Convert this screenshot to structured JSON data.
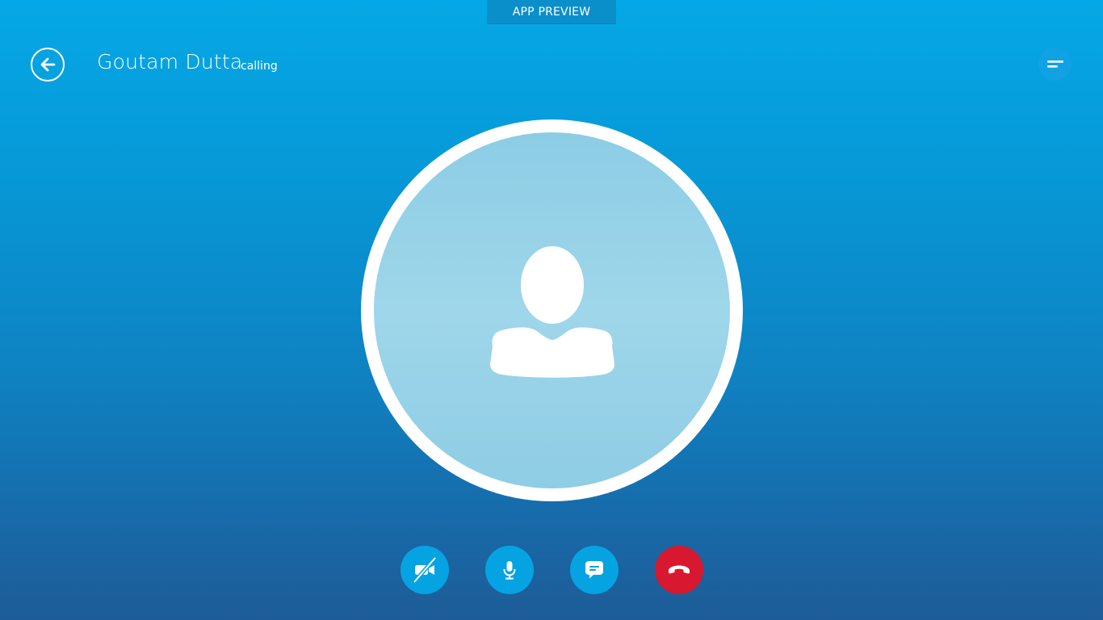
{
  "banner": {
    "label": "APP PREVIEW"
  },
  "header": {
    "contact_name": "Goutam Dutta",
    "status": "calling"
  },
  "icons": {
    "back": "back-arrow-icon",
    "menu": "menu-icon",
    "avatar": "person-avatar-icon",
    "video": "video-off-icon",
    "mic": "microphone-icon",
    "chat": "chat-bubble-icon",
    "end_call": "end-call-icon"
  },
  "colors": {
    "background_top": "#05a8e6",
    "background_bottom": "#1d5c97",
    "control_blue": "#06a3e2",
    "end_call_red": "#d7182e"
  }
}
